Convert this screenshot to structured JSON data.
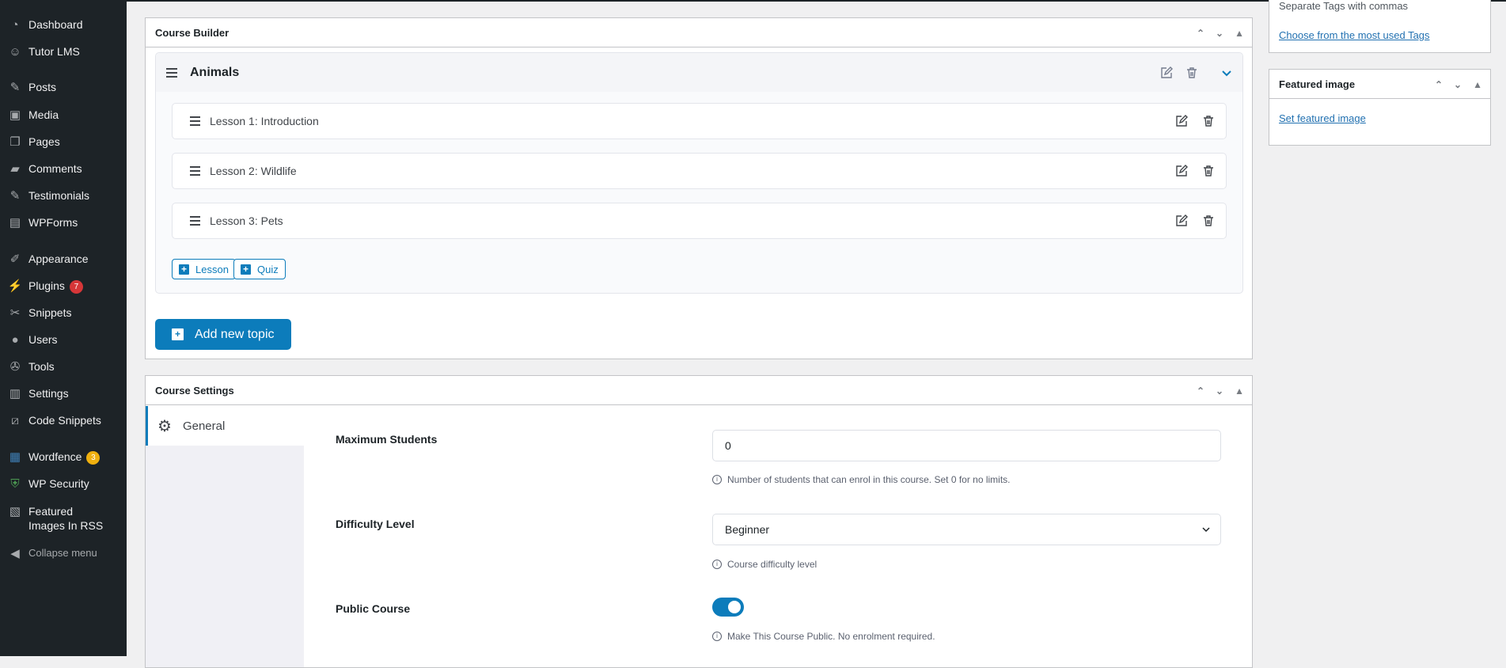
{
  "sidebar": {
    "items": [
      {
        "label": "Dashboard",
        "icon": "dashboard-icon"
      },
      {
        "label": "Tutor LMS",
        "icon": "tutor-icon"
      },
      {
        "label": "Posts",
        "icon": "pin-icon"
      },
      {
        "label": "Media",
        "icon": "media-icon"
      },
      {
        "label": "Pages",
        "icon": "pages-icon"
      },
      {
        "label": "Comments",
        "icon": "comment-icon"
      },
      {
        "label": "Testimonials",
        "icon": "pin-icon"
      },
      {
        "label": "WPForms",
        "icon": "forms-icon"
      },
      {
        "label": "Appearance",
        "icon": "brush-icon"
      },
      {
        "label": "Plugins",
        "icon": "plugin-icon",
        "badge": "7"
      },
      {
        "label": "Snippets",
        "icon": "scissors-icon"
      },
      {
        "label": "Users",
        "icon": "user-icon"
      },
      {
        "label": "Tools",
        "icon": "wrench-icon"
      },
      {
        "label": "Settings",
        "icon": "settings-icon"
      },
      {
        "label": "Code Snippets",
        "icon": "code-icon"
      },
      {
        "label": "Wordfence",
        "icon": "wordfence-icon",
        "badge": "3"
      },
      {
        "label": "WP Security",
        "icon": "shield-icon"
      },
      {
        "label": "Featured Images In RSS",
        "icon": "images-icon"
      }
    ],
    "collapse": "Collapse menu",
    "badge_colors": {
      "plugins": "#d63638",
      "wordfence": "#f0b00f"
    }
  },
  "builder": {
    "title": "Course Builder",
    "topic": {
      "title": "Animals",
      "lessons": [
        "Lesson 1: Introduction",
        "Lesson 2: Wildlife",
        "Lesson 3: Pets"
      ],
      "add_lesson": "Lesson",
      "add_quiz": "Quiz"
    },
    "add_topic": "Add new topic"
  },
  "settings": {
    "title": "Course Settings",
    "tab": "General",
    "max_students": {
      "label": "Maximum Students",
      "value": "0",
      "help": "Number of students that can enrol in this course. Set 0 for no limits."
    },
    "difficulty": {
      "label": "Difficulty Level",
      "value": "Beginner",
      "help": "Course difficulty level"
    },
    "public": {
      "label": "Public Course",
      "on": true,
      "help": "Make This Course Public. No enrolment required."
    }
  },
  "tags": {
    "hint": "Separate Tags with commas",
    "link": "Choose from the most used Tags"
  },
  "featured": {
    "title": "Featured image",
    "link": "Set featured image"
  },
  "accent": "#0c7cbb"
}
